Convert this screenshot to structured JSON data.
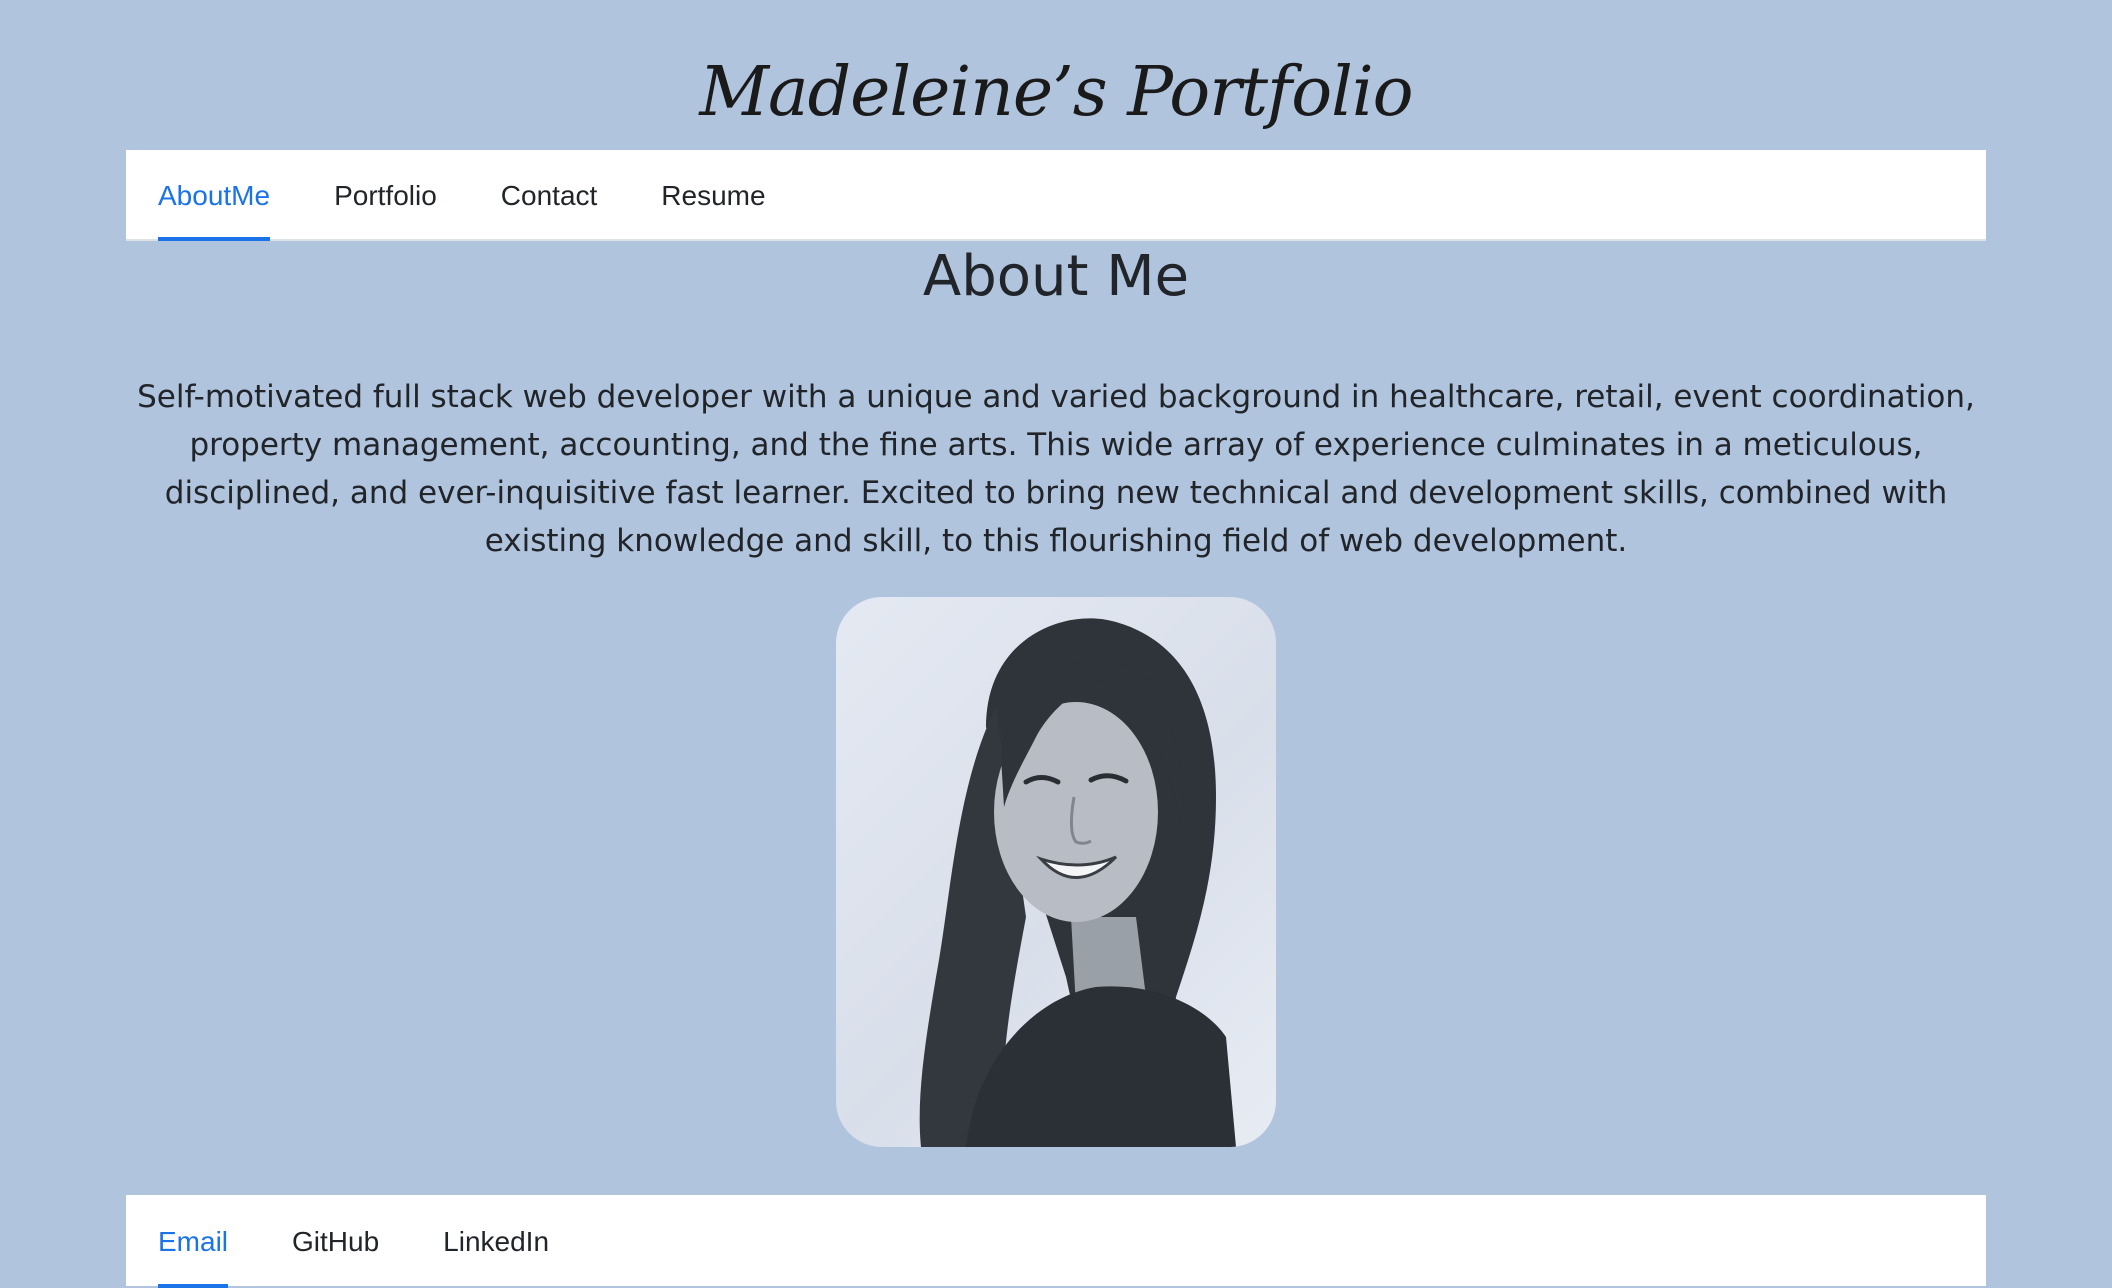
{
  "header": {
    "title": "Madeleine’s Portfolio"
  },
  "nav": {
    "items": [
      {
        "label": "AboutMe",
        "active": true
      },
      {
        "label": "Portfolio",
        "active": false
      },
      {
        "label": "Contact",
        "active": false
      },
      {
        "label": "Resume",
        "active": false
      }
    ]
  },
  "about": {
    "heading": "About Me",
    "bio": "Self-motivated full stack web developer with a unique and varied background in healthcare, retail, event coordination, property management, accounting, and the fine arts. This wide array of experience culminates in a meticulous, disciplined, and ever-inquisitive fast learner. Excited to bring new technical and development skills, combined with existing knowledge and skill, to this flourishing field of web development."
  },
  "footer": {
    "items": [
      {
        "label": "Email",
        "active": true
      },
      {
        "label": "GitHub",
        "active": false
      },
      {
        "label": "LinkedIn",
        "active": false
      }
    ]
  },
  "colors": {
    "background": "#b0c4de",
    "accent": "#1a73e8",
    "text": "#212529",
    "bar": "#ffffff"
  }
}
